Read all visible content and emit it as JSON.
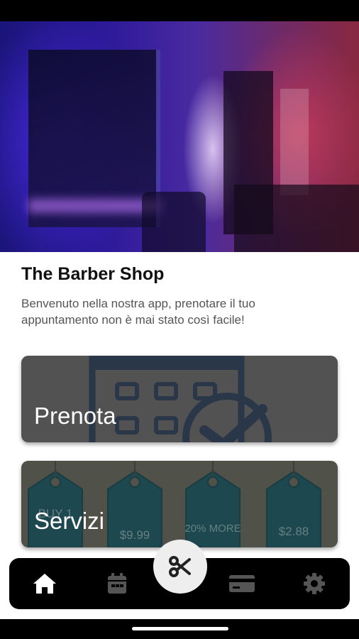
{
  "shop": {
    "title": "The Barber Shop",
    "description": "Benvenuto nella nostra app, prenotare il tuo appuntamento non è mai stato così facile!"
  },
  "cards": {
    "prenota_label": "Prenota",
    "servizi_label": "Servizi"
  },
  "price_tags": [
    "BUY 1",
    "$9.99",
    "20% MORE",
    "$2.88"
  ],
  "nav": {
    "items": [
      {
        "icon": "home-icon",
        "active": true
      },
      {
        "icon": "calendar-icon",
        "active": false
      },
      {
        "icon": "scissors-icon",
        "active": false
      },
      {
        "icon": "credit-card-icon",
        "active": false
      },
      {
        "icon": "gear-icon",
        "active": false
      }
    ]
  },
  "colors": {
    "nav_background": "#000000",
    "nav_icon_active": "#ffffff",
    "nav_icon_inactive": "#555555",
    "fab_background": "#eeeeee",
    "calendar_art": "#1f3550",
    "tag_fill": "#0d4f5a"
  }
}
